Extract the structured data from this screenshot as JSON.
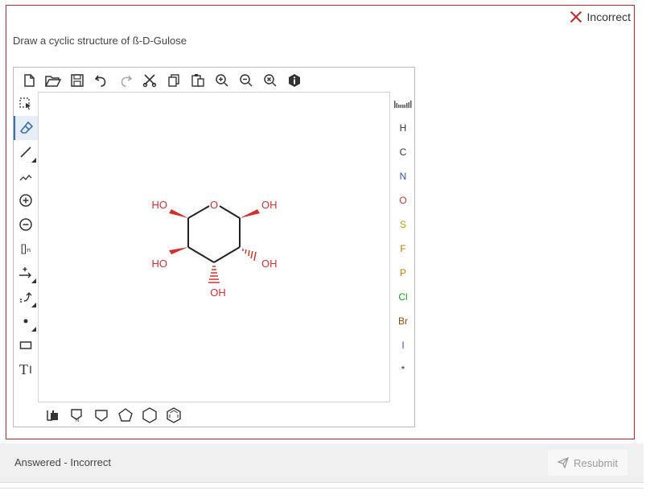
{
  "status": {
    "label": "Incorrect"
  },
  "question": {
    "text": "Draw a cyclic structure of ß-D-Gulose"
  },
  "editor": {
    "left_tools": {
      "sgroup": "[]ₙ",
      "text": "T"
    },
    "elements": [
      "H",
      "C",
      "N",
      "O",
      "S",
      "F",
      "P",
      "Cl",
      "Br",
      "I",
      "*"
    ],
    "element_colors": [
      "#333333",
      "#333333",
      "#3050b8",
      "#d33a2c",
      "#b3a000",
      "#b07a00",
      "#cc7a00",
      "#1e9e1e",
      "#8b4513",
      "#7a2fb0",
      "#333333"
    ],
    "molecule_labels": {
      "ring_o": "O",
      "oh_top_left": "HO",
      "oh_top_right": "OH",
      "oh_mid_left": "HO",
      "oh_mid_right": "OH",
      "oh_bottom": "OH"
    }
  },
  "footer": {
    "status_text": "Answered - Incorrect",
    "resubmit_label": "Resubmit"
  }
}
